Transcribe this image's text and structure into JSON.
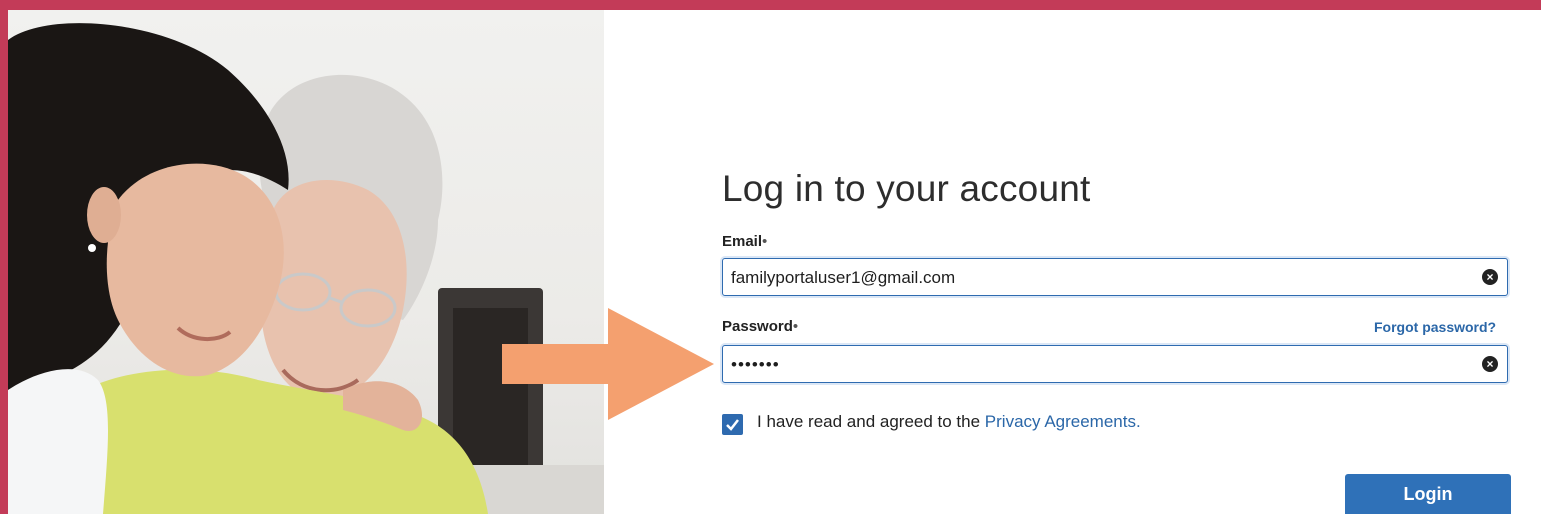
{
  "page": {
    "frame_color": "#c33b58",
    "accent_color": "#2f71b8",
    "arrow_color": "#f4a06f"
  },
  "illustration": {
    "subject": "caregiver and elderly woman smiling",
    "icon": "people-photo"
  },
  "login_form": {
    "title": "Log in to your account",
    "email": {
      "label": "Email",
      "required_mark": "•",
      "value": "familyportaluser1@gmail.com"
    },
    "password": {
      "label": "Password",
      "required_mark": "•",
      "masked_value": "•••••••",
      "forgot_label": "Forgot password?"
    },
    "agreement": {
      "checked": true,
      "text": "I have read and agreed to the ",
      "link": "Privacy Agreements."
    },
    "login_label": "Login"
  }
}
